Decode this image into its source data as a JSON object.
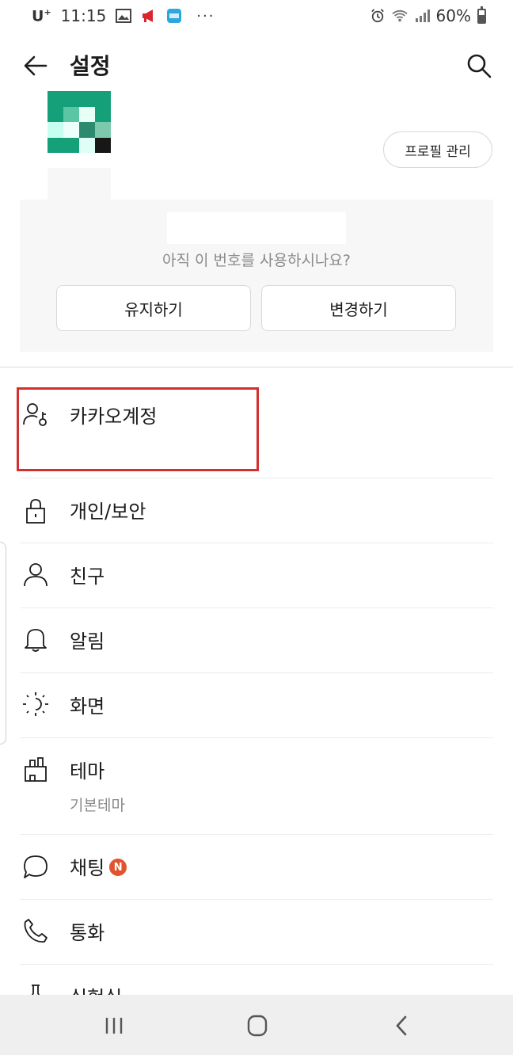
{
  "status_bar": {
    "carrier": "U",
    "carrier_sup": "+",
    "time": "11:15",
    "more": "···",
    "battery": "60%"
  },
  "app_bar": {
    "title": "설정"
  },
  "profile": {
    "manage_button": "프로필 관리"
  },
  "number_card": {
    "question": "아직 이 번호를 사용하시나요?",
    "keep_button": "유지하기",
    "change_button": "변경하기"
  },
  "menu": {
    "items": [
      {
        "label": "카카오계정",
        "icon": "account-key-icon"
      },
      {
        "label": "개인/보안",
        "icon": "lock-icon"
      },
      {
        "label": "친구",
        "icon": "person-icon"
      },
      {
        "label": "알림",
        "icon": "bell-icon"
      },
      {
        "label": "화면",
        "icon": "brightness-icon"
      },
      {
        "label": "테마",
        "sublabel": "기본테마",
        "icon": "theme-brush-icon"
      },
      {
        "label": "채팅",
        "badge": "N",
        "icon": "chat-bubble-icon"
      },
      {
        "label": "통화",
        "icon": "phone-icon"
      },
      {
        "label": "실험실",
        "icon": "flask-icon"
      }
    ]
  },
  "colors": {
    "highlight_border": "#d32f2f",
    "new_badge": "#e0542f",
    "avatar_green": "#13a07a"
  }
}
